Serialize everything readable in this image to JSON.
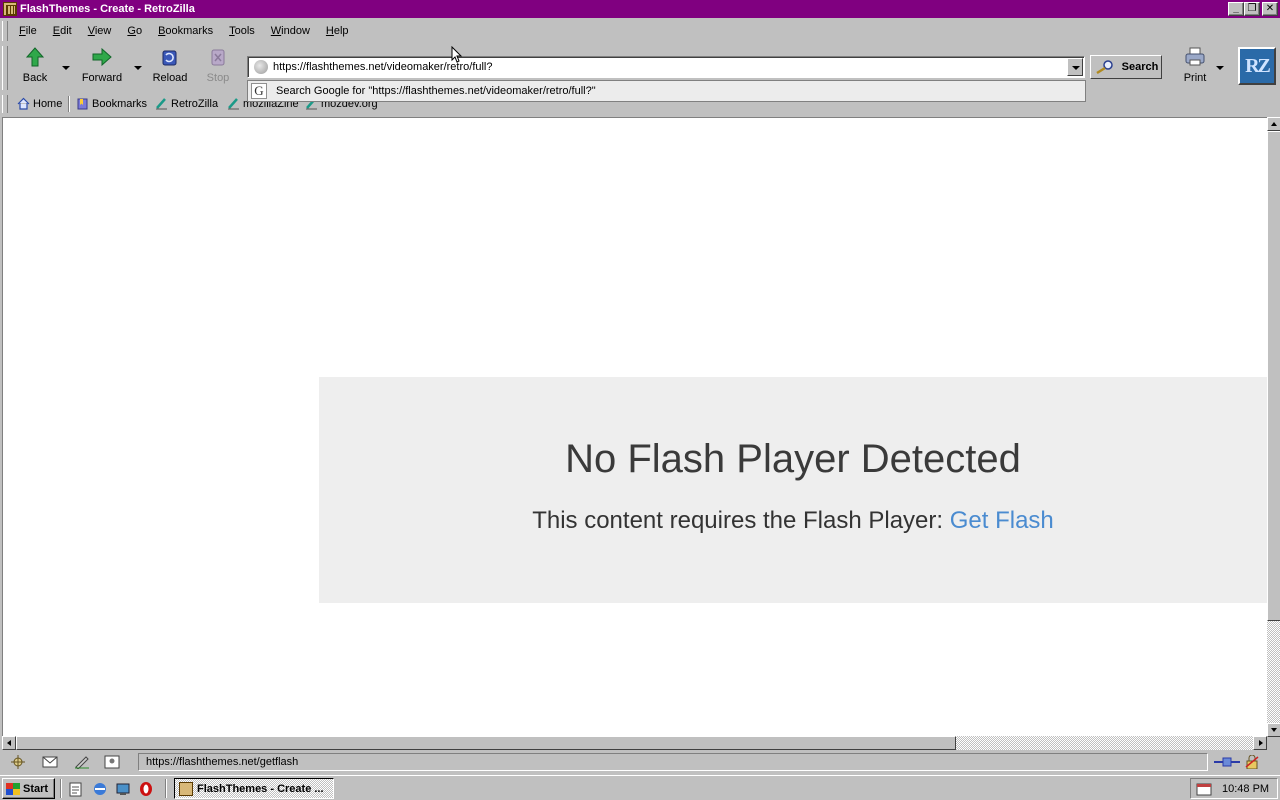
{
  "window": {
    "title": "FlashThemes - Create - RetroZilla",
    "controls": {
      "minimize": "_",
      "restore": "❐",
      "close": "✕"
    }
  },
  "menubar": {
    "items": [
      "File",
      "Edit",
      "View",
      "Go",
      "Bookmarks",
      "Tools",
      "Window",
      "Help"
    ]
  },
  "toolbar": {
    "back_label": "Back",
    "forward_label": "Forward",
    "reload_label": "Reload",
    "stop_label": "Stop",
    "print_label": "Print",
    "search_label": "Search",
    "logo_text": "RZ"
  },
  "urlbar": {
    "value": "https://flashthemes.net/videomaker/retro/full?"
  },
  "autocomplete": {
    "icon_letter": "G",
    "suggestion": "Search Google for \"https://flashthemes.net/videomaker/retro/full?\""
  },
  "personal_toolbar": {
    "items": [
      "Home",
      "Bookmarks",
      "RetroZilla",
      "mozillaZine",
      "mozdev.org"
    ]
  },
  "page": {
    "heading": "No Flash Player Detected",
    "message": "This content requires the Flash Player:",
    "link_text": "Get Flash"
  },
  "status": {
    "text": "https://flashthemes.net/getflash"
  },
  "taskbar": {
    "start_label": "Start",
    "task_label": "FlashThemes - Create ...",
    "clock": "10:48 PM"
  },
  "colors": {
    "title_bar": "#800080",
    "link": "#4a8bd0",
    "flash_box_bg": "#eeeeee",
    "chrome": "#c0c0c0"
  }
}
